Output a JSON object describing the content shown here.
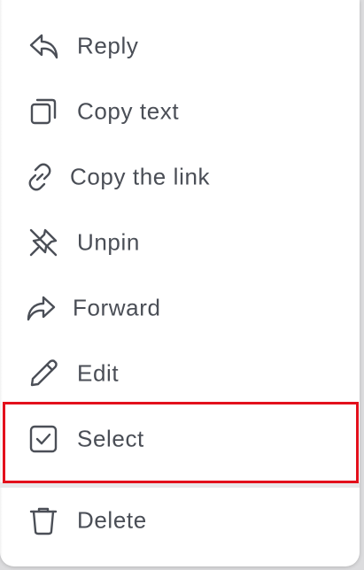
{
  "menu": {
    "items": [
      {
        "label": "Reply",
        "icon": "reply-icon"
      },
      {
        "label": "Copy text",
        "icon": "copy-icon"
      },
      {
        "label": "Copy the link",
        "icon": "link-icon"
      },
      {
        "label": "Unpin",
        "icon": "unpin-icon"
      },
      {
        "label": "Forward",
        "icon": "forward-icon"
      },
      {
        "label": "Edit",
        "icon": "pencil-icon"
      },
      {
        "label": "Select",
        "icon": "checkbox-icon",
        "highlighted": true
      },
      {
        "label": "Delete",
        "icon": "trash-icon"
      }
    ],
    "highlight_color": "#e3101c",
    "text_color": "#4a4e56"
  }
}
